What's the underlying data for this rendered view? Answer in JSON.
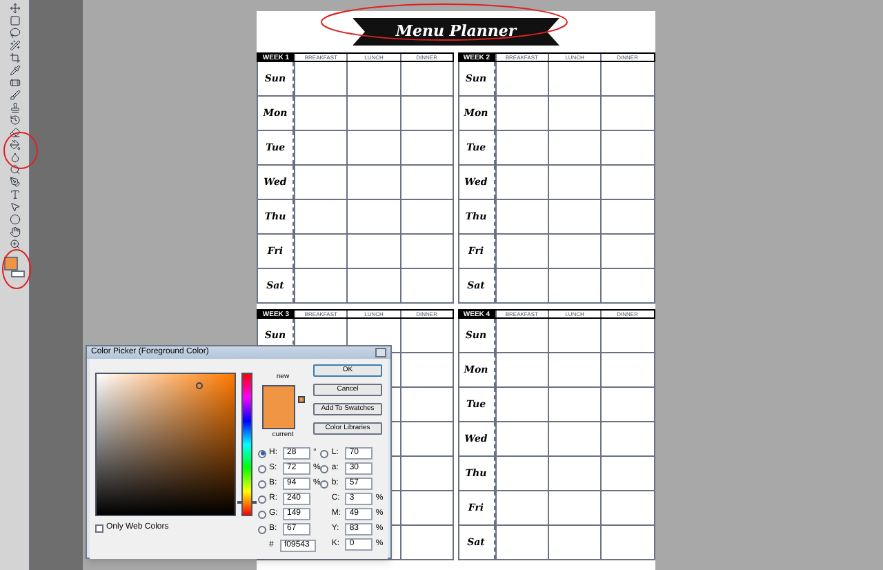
{
  "page": {
    "title": "Menu Planner",
    "weeks": [
      {
        "label": "WEEK 1",
        "columns": [
          "BREAKFAST",
          "LUNCH",
          "DINNER"
        ],
        "days": [
          "Sun",
          "Mon",
          "Tue",
          "Wed",
          "Thu",
          "Fri",
          "Sat"
        ]
      },
      {
        "label": "WEEK 2",
        "columns": [
          "BREAKFAST",
          "LUNCH",
          "DINNER"
        ],
        "days": [
          "Sun",
          "Mon",
          "Tue",
          "Wed",
          "Thu",
          "Fri",
          "Sat"
        ]
      },
      {
        "label": "WEEK 3",
        "columns": [
          "BREAKFAST",
          "LUNCH",
          "DINNER"
        ],
        "days": [
          "Sun"
        ]
      },
      {
        "label": "WEEK 4",
        "columns": [
          "BREAKFAST",
          "LUNCH",
          "DINNER"
        ],
        "days": [
          "Sun",
          "Mon",
          "Tue",
          "Wed",
          "Thu",
          "Fri",
          "Sat"
        ]
      }
    ]
  },
  "color_picker": {
    "title": "Color Picker (Foreground Color)",
    "new_label": "new",
    "current_label": "current",
    "hue_slider": {
      "level": 0.08
    },
    "buttons": [
      "OK",
      "Cancel",
      "Add To Swatches",
      "Color Libraries"
    ],
    "left_fields": [
      {
        "label": "H:",
        "value": "28",
        "unit": "°",
        "kind": "radio",
        "selected": true
      },
      {
        "label": "S:",
        "value": "72",
        "unit": "%",
        "kind": "radio",
        "selected": false
      },
      {
        "label": "B:",
        "value": "94",
        "unit": "%",
        "kind": "radio",
        "selected": false
      },
      {
        "label": "R:",
        "value": "240",
        "kind": "radio",
        "selected": false
      },
      {
        "label": "G:",
        "value": "149",
        "kind": "radio",
        "selected": false
      },
      {
        "label": "B:",
        "value": "67",
        "kind": "radio",
        "selected": false
      }
    ],
    "right_fields": [
      {
        "label": "L:",
        "value": "70",
        "kind": "radio",
        "selected": false
      },
      {
        "label": "a:",
        "value": "30",
        "kind": "radio",
        "selected": false
      },
      {
        "label": "b:",
        "value": "57",
        "kind": "radio",
        "selected": false
      },
      {
        "label": "C:",
        "value": "3",
        "unit": "%",
        "kind": "plain"
      },
      {
        "label": "M:",
        "value": "49",
        "unit": "%",
        "kind": "plain"
      },
      {
        "label": "Y:",
        "value": "83",
        "unit": "%",
        "kind": "plain"
      },
      {
        "label": "K:",
        "value": "0",
        "unit": "%",
        "kind": "plain"
      }
    ],
    "hex": {
      "label": "#",
      "value": "f09543"
    },
    "only_web_colors": {
      "label": "Only Web Colors",
      "checked": false
    }
  }
}
